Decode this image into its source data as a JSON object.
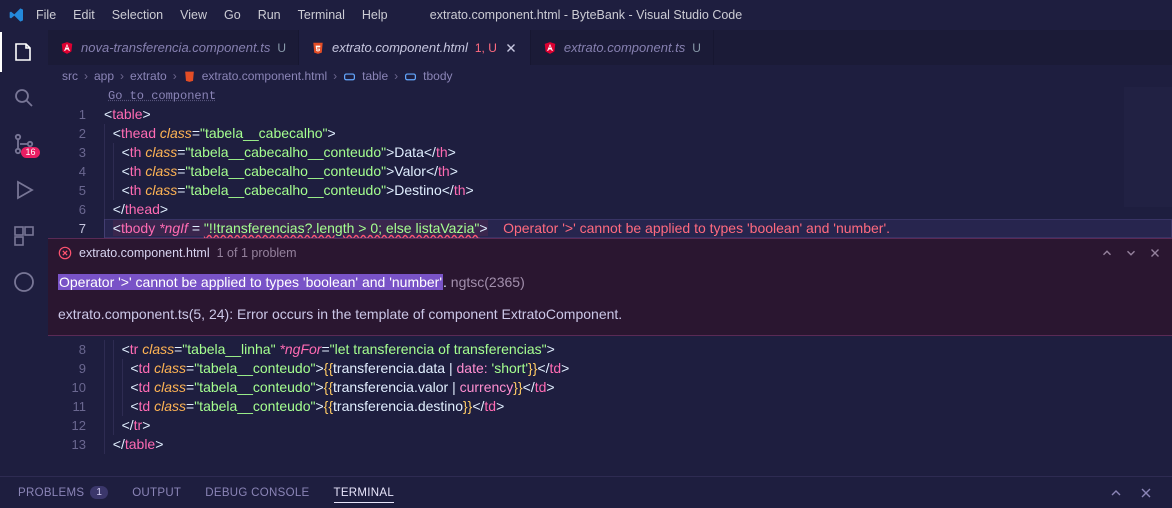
{
  "titlebar": {
    "menus": [
      "File",
      "Edit",
      "Selection",
      "View",
      "Go",
      "Run",
      "Terminal",
      "Help"
    ],
    "title": "extrato.component.html - ByteBank - Visual Studio Code"
  },
  "activity": {
    "scm_badge": "16"
  },
  "tabs": {
    "t0": {
      "label": "nova-transferencia.component.ts",
      "status": "U",
      "icon": "angular"
    },
    "t1": {
      "label": "extrato.component.html",
      "mod": "1, U",
      "icon": "html"
    },
    "t2": {
      "label": "extrato.component.ts",
      "status": "U",
      "icon": "angular"
    }
  },
  "breadcrumb": {
    "seg0": "src",
    "seg1": "app",
    "seg2": "extrato",
    "seg3": "extrato.component.html",
    "seg4": "table",
    "seg5": "tbody"
  },
  "editor": {
    "goto": "Go to component",
    "lines": [
      "1",
      "2",
      "3",
      "4",
      "5",
      "6",
      "7"
    ],
    "lines2": [
      "8",
      "9",
      "10",
      "11",
      "12",
      "13"
    ],
    "code": {
      "l1_table": "table",
      "l2_thead": "thead",
      "l2_class": "class",
      "l2_val": "\"tabela__cabecalho\"",
      "th": "th",
      "th_class": "class",
      "th_val": "\"tabela__cabecalho__conteudo\"",
      "th_data": "Data",
      "th_valor": "Valor",
      "th_dest": "Destino",
      "tbody": "tbody",
      "ngif": "*ngIf",
      "ngif_val": "\"!!transferencias?.length > 0; else listaVazia\"",
      "tr": "tr",
      "tr_class": "class",
      "tr_val": "\"tabela__linha\"",
      "ngfor": "*ngFor",
      "ngfor_val": "\"let transferencia of transferencias\"",
      "td": "td",
      "td_class": "class",
      "td_val": "\"tabela__conteudo\"",
      "exp_data_open": "{{",
      "exp_data_close": "}}",
      "exp_data": "transferencia.data ",
      "pipe_date": " date: ",
      "pipe_date_arg": "'short'",
      "exp_valor": "transferencia.valor ",
      "pipe_curr": " currency",
      "exp_dest": "transferencia.destino"
    },
    "inline_error": "Operator '>' cannot be applied to types 'boolean' and 'number'."
  },
  "peek": {
    "file": "extrato.component.html",
    "count": "1 of 1 problem",
    "msg": "Operator '>' cannot be applied to types 'boolean' and 'number'",
    "msg_tail": ".",
    "code": " ngtsc(2365)",
    "sub": "extrato.component.ts(5, 24): Error occurs in the template of component ExtratoComponent."
  },
  "panel": {
    "problems": "Problems",
    "problems_n": "1",
    "output": "Output",
    "debug": "Debug Console",
    "terminal": "Terminal"
  }
}
